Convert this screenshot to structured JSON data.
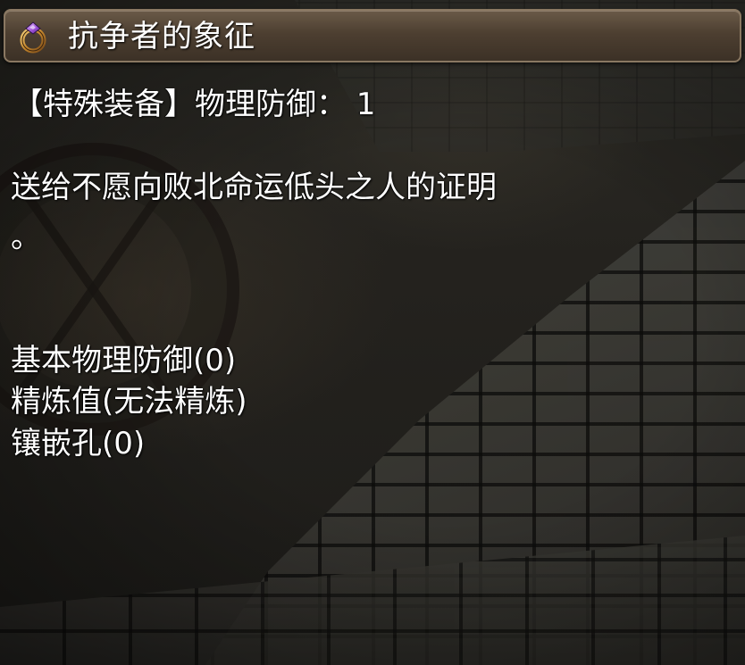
{
  "item": {
    "icon": "ring-icon",
    "name": "抗争者的象征"
  },
  "type_line": "【特殊装备】物理防御： 1",
  "description": {
    "line1": "送给不愿向败北命运低头之人的证明",
    "line2": "。"
  },
  "stats": {
    "base_defense": "基本物理防御(0)",
    "refine": "精炼值(无法精炼)",
    "socket": "镶嵌孔(0)"
  },
  "colors": {
    "text": "#ffffff",
    "title_bar": "#4d3f31",
    "title_border": "#8a7862"
  }
}
